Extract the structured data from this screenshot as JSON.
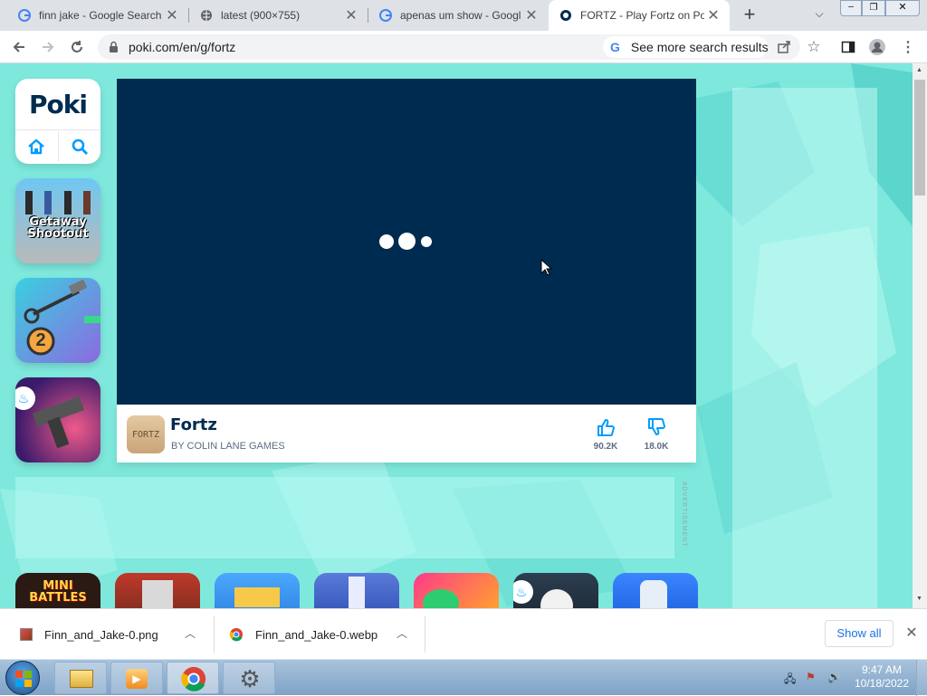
{
  "browser": {
    "tabs": [
      {
        "title": "finn jake - Google Search",
        "icon": "google-icon"
      },
      {
        "title": "latest (900×755)",
        "icon": "globe-icon"
      },
      {
        "title": "apenas um show - Googl",
        "icon": "google-icon"
      },
      {
        "title": "FORTZ - Play Fortz on Po",
        "icon": "poki-icon",
        "active": true
      }
    ],
    "url": "poki.com/en/g/fortz",
    "search_chip": "See more search results"
  },
  "poki": {
    "logo": "Poki"
  },
  "game": {
    "title": "Fortz",
    "developer": "BY COLIN LANE GAMES",
    "thumb_text": "FORTZ",
    "likes": "90.2K",
    "dislikes": "18.0K"
  },
  "ad_label": "ADVERTISEMENT",
  "thumbnails": [
    {
      "name": "Getaway Shootout",
      "text": "Getaway Shootout"
    },
    {
      "name": "Hammer game 2",
      "text": "2"
    },
    {
      "name": "Uzi game",
      "text": ""
    }
  ],
  "bottom_thumbnails": [
    {
      "name": "Mini Battles",
      "text": "MINI BATTLES"
    },
    {
      "name": "Game 2",
      "text": ""
    },
    {
      "name": "Game 3",
      "text": ""
    },
    {
      "name": "Game 4",
      "text": ""
    },
    {
      "name": "Game 5",
      "text": ""
    },
    {
      "name": "Game 6",
      "text": ""
    },
    {
      "name": "Game 7",
      "text": ""
    }
  ],
  "downloads": [
    {
      "file": "Finn_and_Jake-0.png",
      "icon": "image-file-icon"
    },
    {
      "file": "Finn_and_Jake-0.webp",
      "icon": "chrome-file-icon"
    }
  ],
  "download_show_all": "Show all",
  "clock": {
    "time": "9:47 AM",
    "date": "10/18/2022"
  },
  "colors": {
    "page_bg": "#7ee8dd",
    "game_bg": "#002b50",
    "poki_blue": "#009cff"
  }
}
